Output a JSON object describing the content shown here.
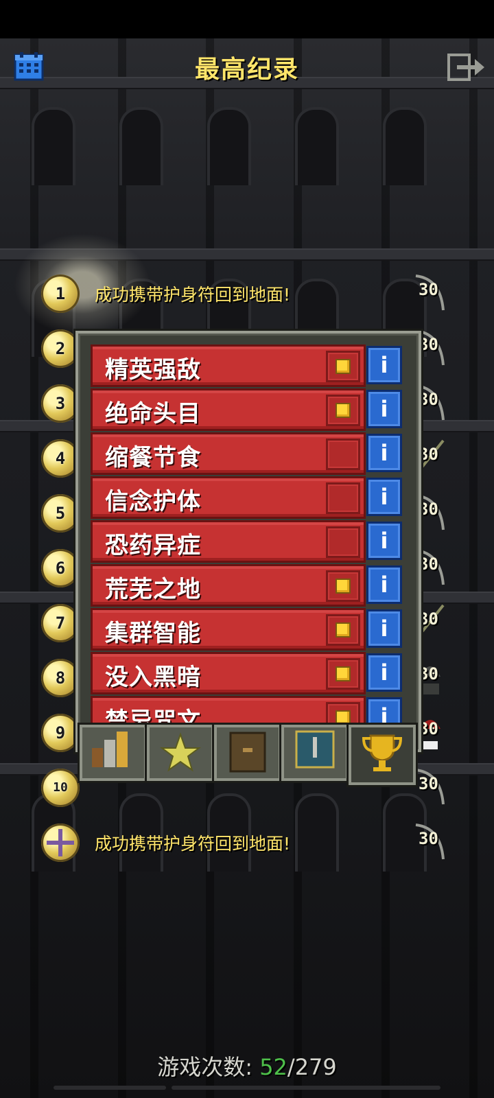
{
  "header": {
    "title": "最高纪录",
    "calendar_icon": "calendar-icon",
    "exit_icon": "exit-icon"
  },
  "records": [
    {
      "rank": "1",
      "text": "成功携带护身符回到地面!",
      "depth": "30"
    },
    {
      "rank": "2",
      "text": "",
      "depth": "30"
    },
    {
      "rank": "3",
      "text": "",
      "depth": "30"
    },
    {
      "rank": "4",
      "text": "",
      "depth": "30"
    },
    {
      "rank": "5",
      "text": "",
      "depth": "30"
    },
    {
      "rank": "6",
      "text": "",
      "depth": "30"
    },
    {
      "rank": "7",
      "text": "",
      "depth": "30"
    },
    {
      "rank": "8",
      "text": "",
      "depth": "30"
    },
    {
      "rank": "9",
      "text": "",
      "depth": "30"
    },
    {
      "rank": "10",
      "text": "",
      "depth": "30"
    }
  ],
  "latest_record": {
    "rank": "",
    "text": "成功携带护身符回到地面!",
    "depth": "30"
  },
  "challenges": [
    {
      "label": "精英强敌",
      "enabled": true
    },
    {
      "label": "绝命头目",
      "enabled": true
    },
    {
      "label": "缩餐节食",
      "enabled": false
    },
    {
      "label": "信念护体",
      "enabled": false
    },
    {
      "label": "恐药异症",
      "enabled": false
    },
    {
      "label": "荒芜之地",
      "enabled": true
    },
    {
      "label": "集群智能",
      "enabled": true
    },
    {
      "label": "没入黑暗",
      "enabled": true
    },
    {
      "label": "禁忌咒文",
      "enabled": true
    }
  ],
  "info_label": "i",
  "tabs": [
    "stats-icon",
    "star-icon",
    "journal-icon",
    "badge-icon",
    "trophy-icon"
  ],
  "footer": {
    "label": "游戏次数:",
    "current": "52",
    "total": "/279"
  },
  "colors": {
    "title": "#ffe56a",
    "challenge_bg": "#c63232",
    "info_bg": "#2a6ad0",
    "count_current": "#4ec04a"
  }
}
